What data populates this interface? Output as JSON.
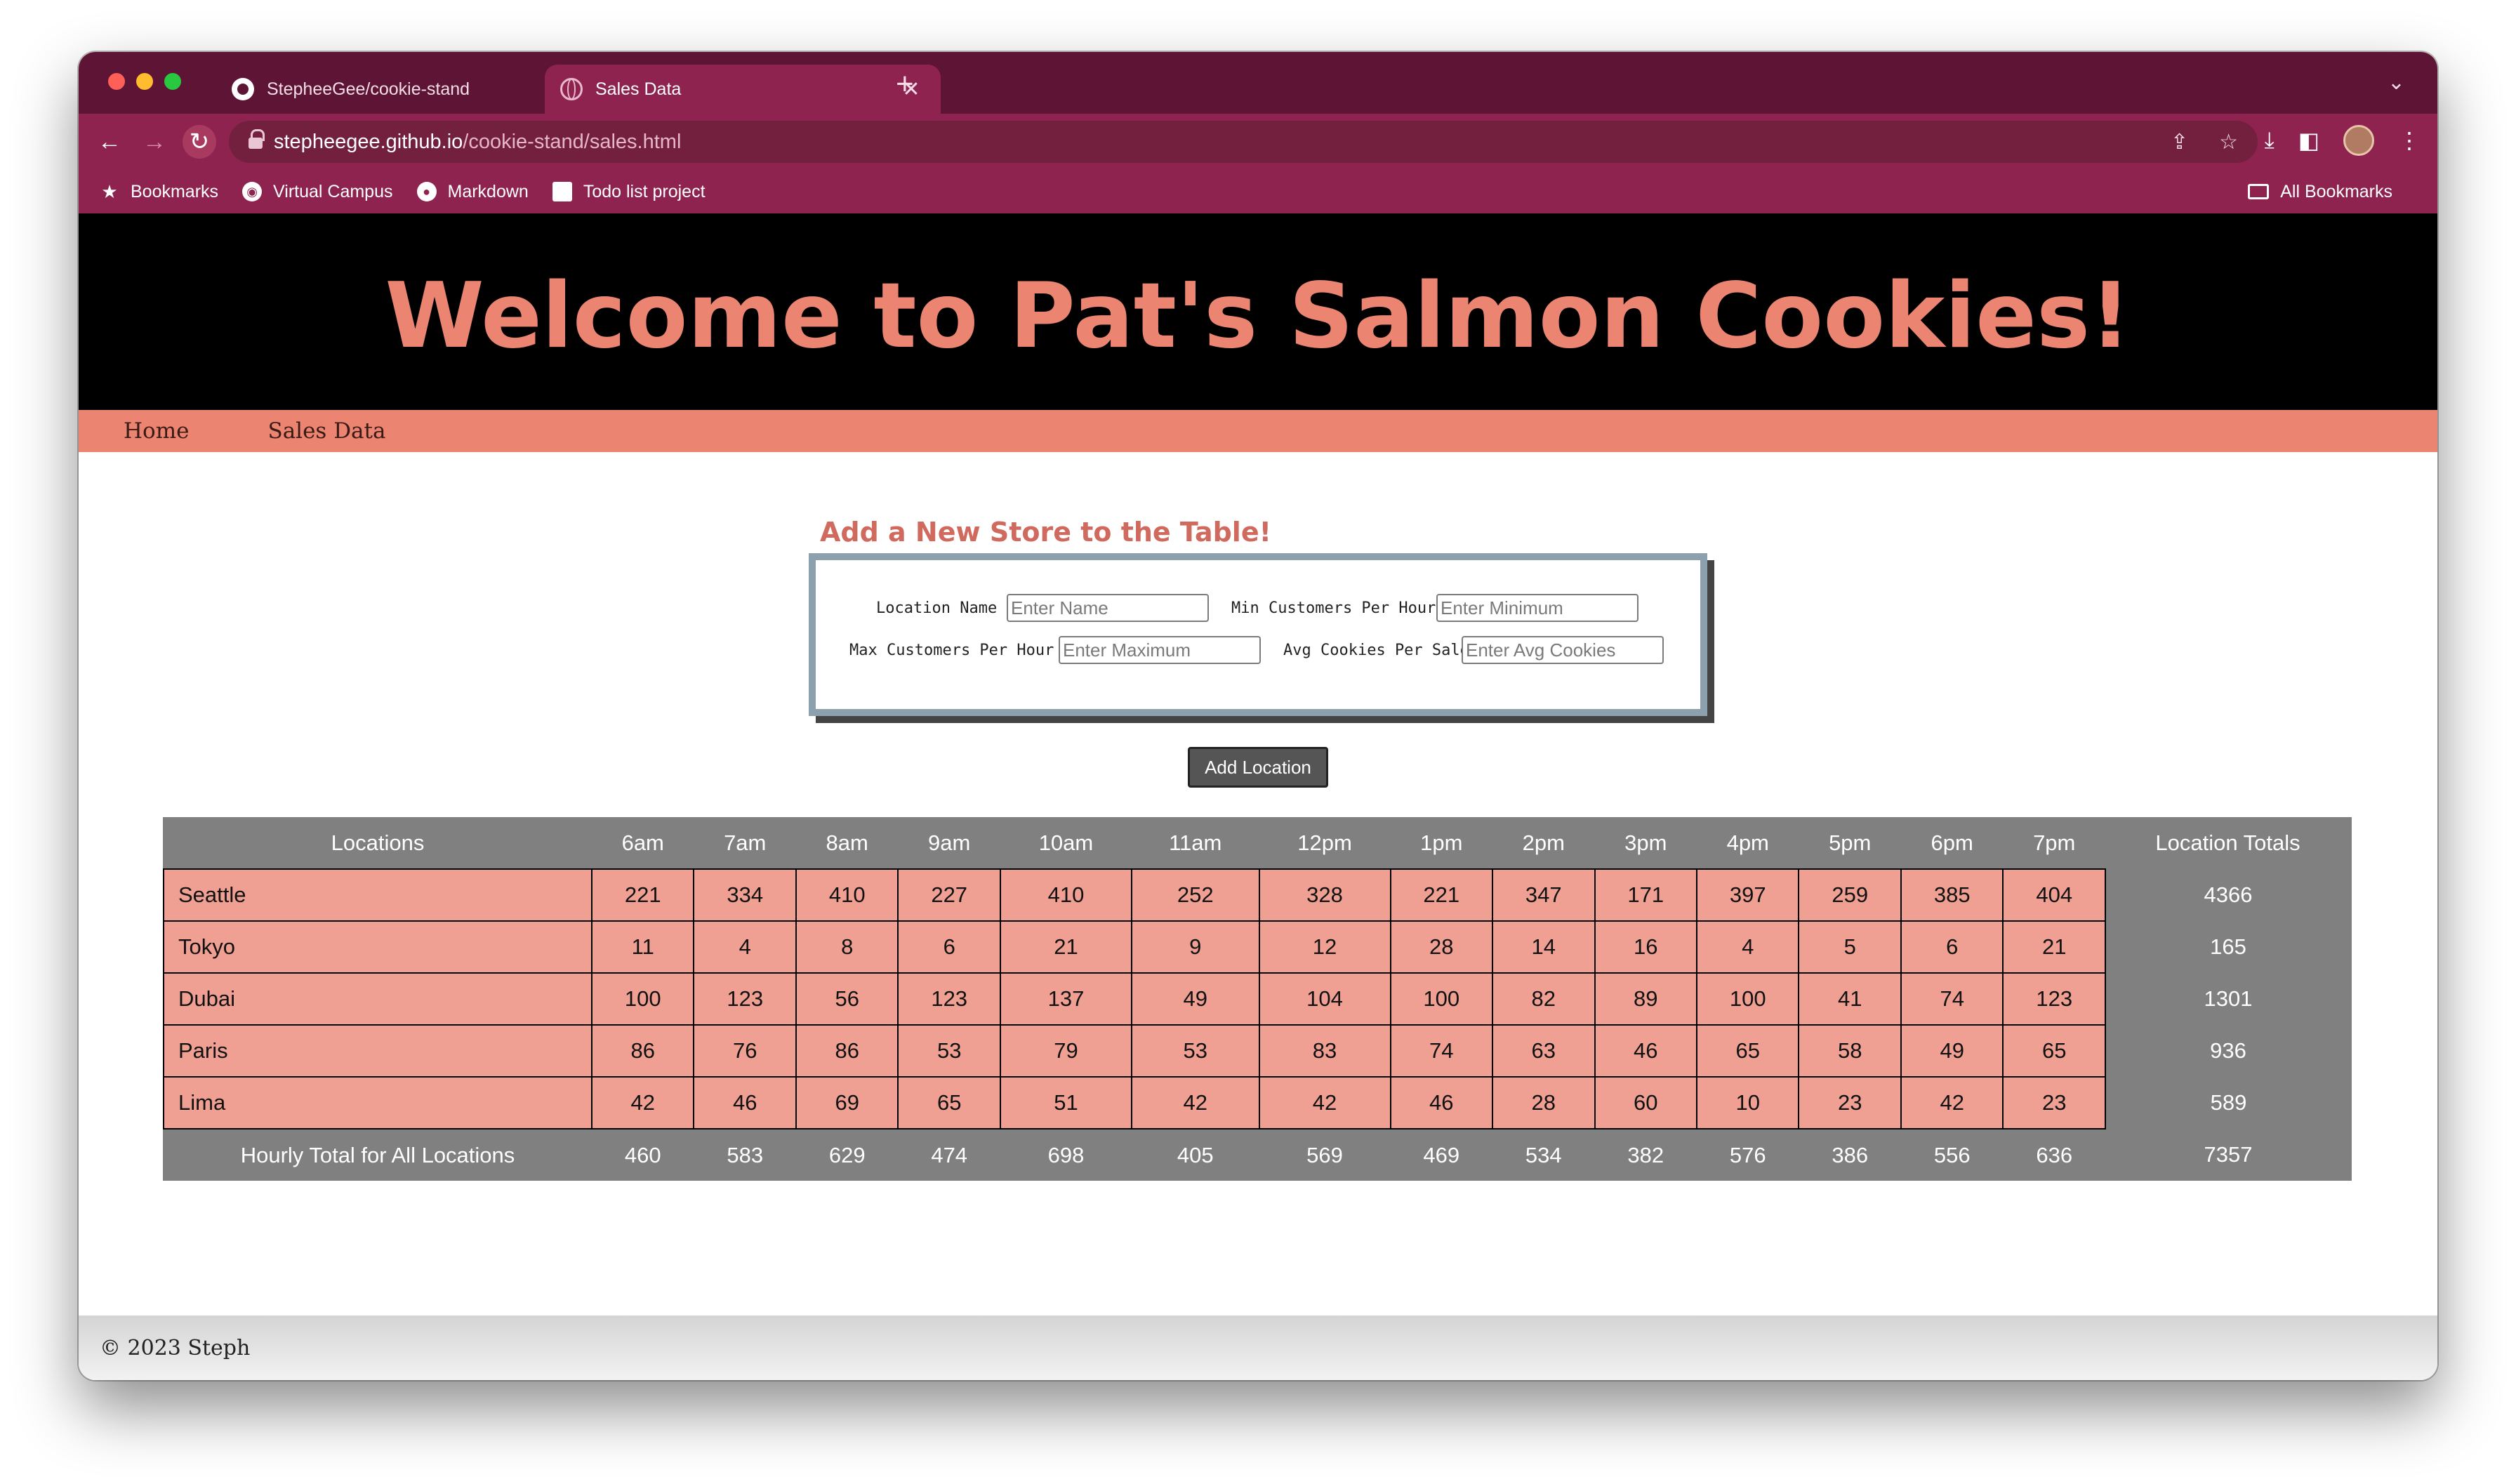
{
  "browser": {
    "tabs": [
      {
        "title": "StepheeGee/cookie-stand",
        "icon": "github-icon"
      },
      {
        "title": "Sales Data",
        "icon": "globe-icon"
      }
    ],
    "url_host": "stepheegee.github.io",
    "url_path": "/cookie-stand/sales.html",
    "bookmarks": [
      "Bookmarks",
      "Virtual Campus",
      "Markdown",
      "Todo list project"
    ],
    "all_bookmarks": "All Bookmarks"
  },
  "site": {
    "title": "Welcome to Pat's Salmon Cookies!",
    "nav": [
      "Home",
      "Sales Data"
    ]
  },
  "form": {
    "heading": "Add a New Store to the Table!",
    "location_label": "Location Name",
    "location_placeholder": "Enter Name",
    "min_label": "Min Customers Per Hour",
    "min_placeholder": "Enter Minimum",
    "max_label": "Max Customers Per Hour",
    "max_placeholder": "Enter Maximum",
    "avg_label": "Avg Cookies Per Sale",
    "avg_placeholder": "Enter Avg Cookies",
    "submit_label": "Add Location"
  },
  "table": {
    "headers": [
      "Locations",
      "6am",
      "7am",
      "8am",
      "9am",
      "10am",
      "11am",
      "12pm",
      "1pm",
      "2pm",
      "3pm",
      "4pm",
      "5pm",
      "6pm",
      "7pm",
      "Location Totals"
    ],
    "rows": [
      {
        "name": "Seattle",
        "values": [
          221,
          334,
          410,
          227,
          410,
          252,
          328,
          221,
          347,
          171,
          397,
          259,
          385,
          404
        ],
        "total": 4366
      },
      {
        "name": "Tokyo",
        "values": [
          11,
          4,
          8,
          6,
          21,
          9,
          12,
          28,
          14,
          16,
          4,
          5,
          6,
          21
        ],
        "total": 165
      },
      {
        "name": "Dubai",
        "values": [
          100,
          123,
          56,
          123,
          137,
          49,
          104,
          100,
          82,
          89,
          100,
          41,
          74,
          123
        ],
        "total": 1301
      },
      {
        "name": "Paris",
        "values": [
          86,
          76,
          86,
          53,
          79,
          53,
          83,
          74,
          63,
          46,
          65,
          58,
          49,
          65
        ],
        "total": 936
      },
      {
        "name": "Lima",
        "values": [
          42,
          46,
          69,
          65,
          51,
          42,
          42,
          46,
          28,
          60,
          10,
          23,
          42,
          23
        ],
        "total": 589
      }
    ],
    "footer_label": "Hourly Total for All Locations",
    "footer_values": [
      460,
      583,
      629,
      474,
      698,
      405,
      569,
      469,
      534,
      382,
      576,
      386,
      556,
      636
    ],
    "footer_total": 7357
  },
  "footer": {
    "text": "© 2023 Steph"
  },
  "colors": {
    "accent": "#ec8472",
    "header_bg": "#000000",
    "table_cell": "#f0a092",
    "table_header": "#808080",
    "browser_frame": "#8f2350"
  }
}
